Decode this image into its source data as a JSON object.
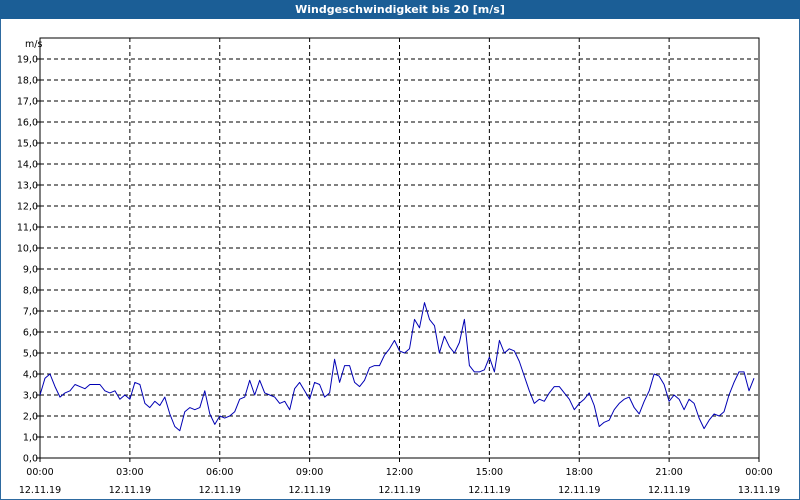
{
  "window": {
    "title": "Windgeschwindigkeit bis 20 [m/s]"
  },
  "colors": {
    "title_bar": "#1b5e96",
    "series_line": "#0000b4",
    "grid": "#000000"
  },
  "chart_data": {
    "type": "line",
    "title": "Windgeschwindigkeit bis 20 [m/s]",
    "ylabel": "m/s",
    "xlabel": "",
    "ylim": [
      0,
      20
    ],
    "y_ticks": [
      "0,0",
      "1,0",
      "2,0",
      "3,0",
      "4,0",
      "5,0",
      "6,0",
      "7,0",
      "8,0",
      "9,0",
      "10,0",
      "11,0",
      "12,0",
      "13,0",
      "14,0",
      "15,0",
      "16,0",
      "17,0",
      "18,0",
      "19,0"
    ],
    "xlim": [
      "12.11.19 00:00",
      "13.11.19 00:00"
    ],
    "x_ticks": [
      {
        "time": "00:00",
        "date": "12.11.19"
      },
      {
        "time": "03:00",
        "date": "12.11.19"
      },
      {
        "time": "06:00",
        "date": "12.11.19"
      },
      {
        "time": "09:00",
        "date": "12.11.19"
      },
      {
        "time": "12:00",
        "date": "12.11.19"
      },
      {
        "time": "15:00",
        "date": "12.11.19"
      },
      {
        "time": "18:00",
        "date": "12.11.19"
      },
      {
        "time": "21:00",
        "date": "12.11.19"
      },
      {
        "time": "00:00",
        "date": "13.11.19"
      }
    ],
    "grid": true,
    "grid_style": "dashed",
    "series": [
      {
        "x": [
          "00:00",
          "00:10",
          "00:20",
          "00:30",
          "00:40",
          "00:50",
          "01:00",
          "01:10",
          "01:20",
          "01:30",
          "01:40",
          "01:50",
          "02:00",
          "02:10",
          "02:20",
          "02:30",
          "02:40",
          "02:50",
          "03:00",
          "03:10",
          "03:20",
          "03:30",
          "03:40",
          "03:50",
          "04:00",
          "04:10",
          "04:20",
          "04:30",
          "04:40",
          "04:50",
          "05:00",
          "05:10",
          "05:20",
          "05:30",
          "05:40",
          "05:50",
          "06:00",
          "06:10",
          "06:20",
          "06:30",
          "06:40",
          "06:50",
          "07:00",
          "07:10",
          "07:20",
          "07:30",
          "07:40",
          "07:50",
          "08:00",
          "08:10",
          "08:20",
          "08:30",
          "08:40",
          "08:50",
          "09:00",
          "09:10",
          "09:20",
          "09:30",
          "09:40",
          "09:50",
          "10:00",
          "10:10",
          "10:20",
          "10:30",
          "10:40",
          "10:50",
          "11:00",
          "11:10",
          "11:20",
          "11:30",
          "11:40",
          "11:50",
          "12:00",
          "12:10",
          "12:20",
          "12:30",
          "12:40",
          "12:50",
          "13:00",
          "13:10",
          "13:20",
          "13:30",
          "13:40",
          "13:50",
          "14:00",
          "14:10",
          "14:20",
          "14:30",
          "14:40",
          "14:50",
          "15:00",
          "15:10",
          "15:20",
          "15:30",
          "15:40",
          "15:50",
          "16:00",
          "16:10",
          "16:20",
          "16:30",
          "16:40",
          "16:50",
          "17:00",
          "17:10",
          "17:20",
          "17:30",
          "17:40",
          "17:50",
          "18:00",
          "18:10",
          "18:20",
          "18:30",
          "18:40",
          "18:50",
          "19:00",
          "19:10",
          "19:20",
          "19:30",
          "19:40",
          "19:50",
          "20:00",
          "20:10",
          "20:20",
          "20:30",
          "20:40",
          "20:50",
          "21:00",
          "21:10",
          "21:20",
          "21:30",
          "21:40",
          "21:50",
          "22:00",
          "22:10",
          "22:20",
          "22:30",
          "22:40",
          "22:50",
          "23:00",
          "23:10",
          "23:20",
          "23:30",
          "23:40",
          "23:50"
        ],
        "values": [
          3.0,
          3.8,
          4.0,
          3.4,
          2.9,
          3.1,
          3.2,
          3.5,
          3.4,
          3.3,
          3.5,
          3.5,
          3.5,
          3.2,
          3.1,
          3.2,
          2.8,
          3.0,
          2.8,
          3.6,
          3.5,
          2.6,
          2.4,
          2.7,
          2.5,
          2.9,
          2.1,
          1.5,
          1.3,
          2.2,
          2.4,
          2.3,
          2.4,
          3.2,
          2.1,
          1.6,
          2.0,
          1.9,
          2.0,
          2.2,
          2.8,
          2.9,
          3.7,
          3.0,
          3.7,
          3.1,
          3.0,
          2.9,
          2.6,
          2.7,
          2.3,
          3.3,
          3.6,
          3.2,
          2.8,
          3.6,
          3.5,
          2.9,
          3.1,
          4.7,
          3.6,
          4.4,
          4.4,
          3.6,
          3.4,
          3.7,
          4.3,
          4.4,
          4.4,
          4.9,
          5.2,
          5.6,
          5.1,
          5.0,
          5.2,
          6.6,
          6.2,
          7.4,
          6.6,
          6.3,
          5.0,
          5.8,
          5.3,
          5.0,
          5.5,
          6.6,
          4.4,
          4.1,
          4.1,
          4.2,
          4.8,
          4.1,
          5.6,
          5.0,
          5.2,
          5.1,
          4.6,
          3.9,
          3.2,
          2.6,
          2.8,
          2.7,
          3.1,
          3.4,
          3.4,
          3.1,
          2.8,
          2.3,
          2.6,
          2.8,
          3.1,
          2.5,
          1.5,
          1.7,
          1.8,
          2.3,
          2.6,
          2.8,
          2.9,
          2.4,
          2.1,
          2.7,
          3.2,
          4.0,
          3.9,
          3.5,
          2.7,
          3.0,
          2.8,
          2.3,
          2.8,
          2.6,
          1.9,
          1.4,
          1.8,
          2.1,
          2.0,
          2.2,
          3.0,
          3.6,
          4.1,
          4.1,
          3.2,
          3.8
        ]
      }
    ]
  }
}
